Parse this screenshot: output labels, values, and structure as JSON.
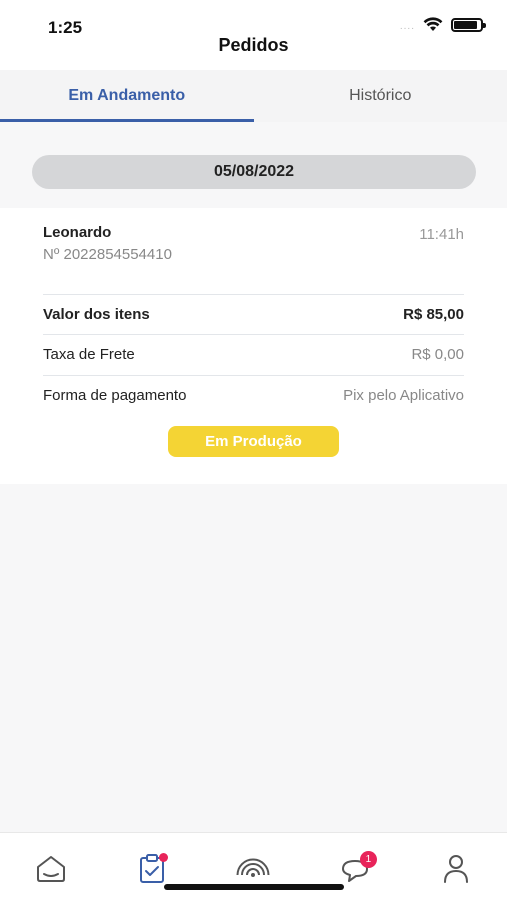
{
  "status_bar": {
    "time": "1:25",
    "signal": "....",
    "icons": [
      "wifi-icon",
      "battery-icon"
    ]
  },
  "header": {
    "title": "Pedidos"
  },
  "tabs": [
    {
      "label": "Em Andamento",
      "active": true
    },
    {
      "label": "Histórico",
      "active": false
    }
  ],
  "date": "05/08/2022",
  "order": {
    "customer": "Leonardo",
    "number": "Nº 2022854554410",
    "time": "11:41h",
    "rows": [
      {
        "label": "Valor dos itens",
        "value": "R$ 85,00"
      },
      {
        "label": "Taxa de Frete",
        "value": "R$ 0,00"
      },
      {
        "label": "Forma de pagamento",
        "value": "Pix pelo Aplicativo"
      }
    ],
    "status_label": "Em Produção"
  },
  "bottom_nav": {
    "items": [
      {
        "icon": "home-icon"
      },
      {
        "icon": "orders-icon",
        "active": true,
        "badge": "dot"
      },
      {
        "icon": "broadcast-icon"
      },
      {
        "icon": "chat-icon",
        "badge": "1"
      },
      {
        "icon": "profile-icon"
      }
    ]
  },
  "colors": {
    "accent": "#3a5fa8",
    "status_yellow": "#f4d434",
    "badge": "#e8245a"
  }
}
